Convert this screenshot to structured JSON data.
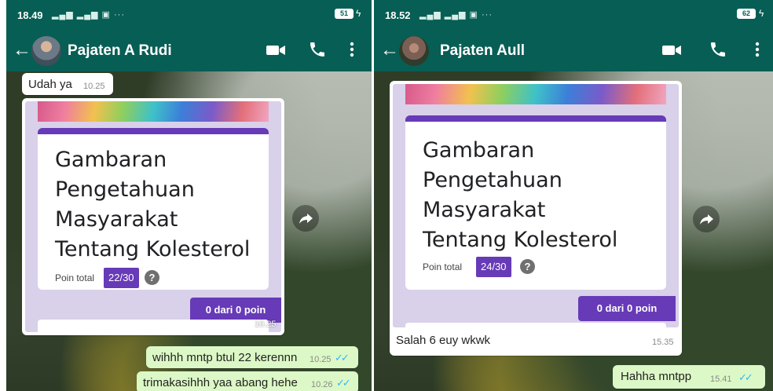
{
  "left": {
    "status": {
      "time": "18.49",
      "battery": "51",
      "signal": ".. …"
    },
    "contact_name": "Pajaten A Rudi",
    "msg_top": {
      "text": "Udah ya",
      "time": "10.25"
    },
    "form": {
      "title_lines": [
        "Gambaran",
        "Pengetahuan",
        "Masyarakat",
        "Tentang Kolesterol"
      ],
      "poin_label": "Poin total",
      "score": "22/30",
      "zero_button": "0 dari 0 poin",
      "time": "10.25"
    },
    "out_messages": [
      {
        "text": "wihhh mntp btul 22 kerennn",
        "time": "10.25"
      },
      {
        "text": "trimakasihhh yaa abang hehe",
        "time": "10.26"
      }
    ]
  },
  "right": {
    "status": {
      "time": "18.52",
      "battery": "62"
    },
    "contact_name": "Pajaten Aull",
    "form": {
      "title_lines": [
        "Gambaran",
        "Pengetahuan",
        "Masyarakat",
        "Tentang Kolesterol"
      ],
      "poin_label": "Poin total",
      "score": "24/30",
      "zero_button": "0 dari 0 poin"
    },
    "msg_caption": {
      "text": "Salah 6 euy wkwk",
      "time": "15.35"
    },
    "out_message": {
      "text": "Hahha mntpp",
      "time": "15.41"
    }
  },
  "colors": {
    "header": "#075e54",
    "outgoing": "#dcf8c6",
    "form_accent": "#673ab7",
    "tick": "#34b7f1"
  },
  "icons": [
    "back-arrow-icon",
    "video-call-icon",
    "phone-icon",
    "more-vert-icon",
    "forward-icon",
    "help-icon",
    "double-check-icon"
  ]
}
